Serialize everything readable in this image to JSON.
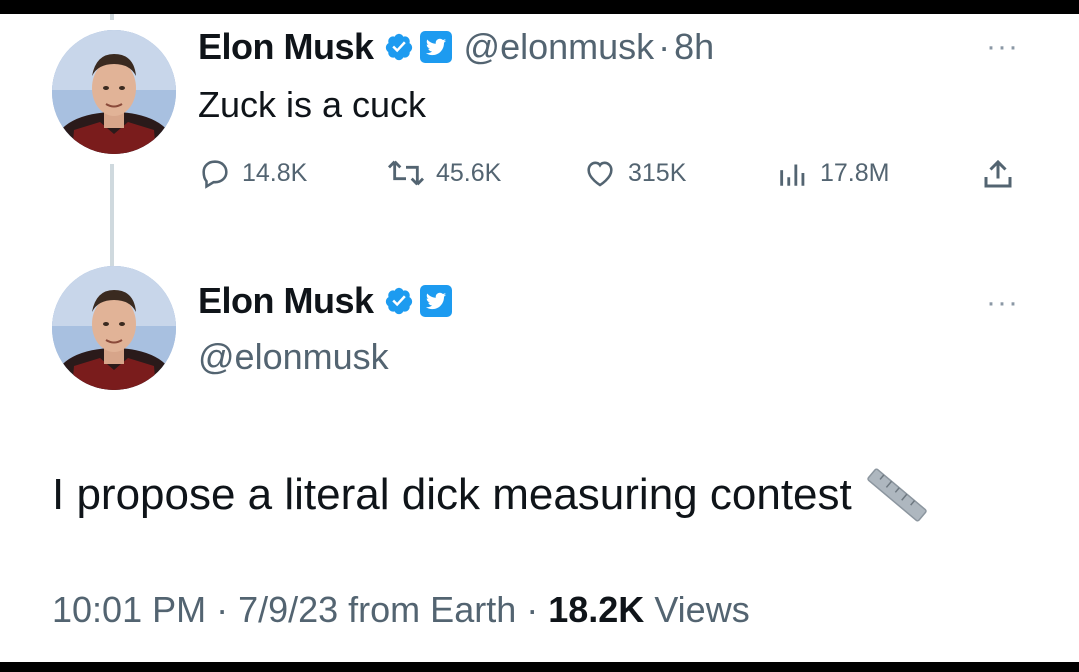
{
  "tweet1": {
    "display_name": "Elon Musk",
    "handle": "@elonmusk",
    "separator": "·",
    "time_ago": "8h",
    "text": "Zuck is a cuck",
    "stats": {
      "replies": "14.8K",
      "retweets": "45.6K",
      "likes": "315K",
      "views": "17.8M"
    },
    "more_icon": "more-horizontal-icon"
  },
  "tweet2": {
    "display_name": "Elon Musk",
    "handle": "@elonmusk",
    "text": "I propose a literal dick measuring contest",
    "emoji_icon": "ruler-icon",
    "timestamp": "10:01 PM · 7/9/23 from Earth · ",
    "views_count": "18.2K",
    "views_label": "Views",
    "more_icon": "more-horizontal-icon"
  },
  "colors": {
    "verified_blue": "#1d9bf0",
    "text_primary": "#0f1419",
    "text_secondary": "#536471",
    "thread_line": "#cfd9de"
  }
}
